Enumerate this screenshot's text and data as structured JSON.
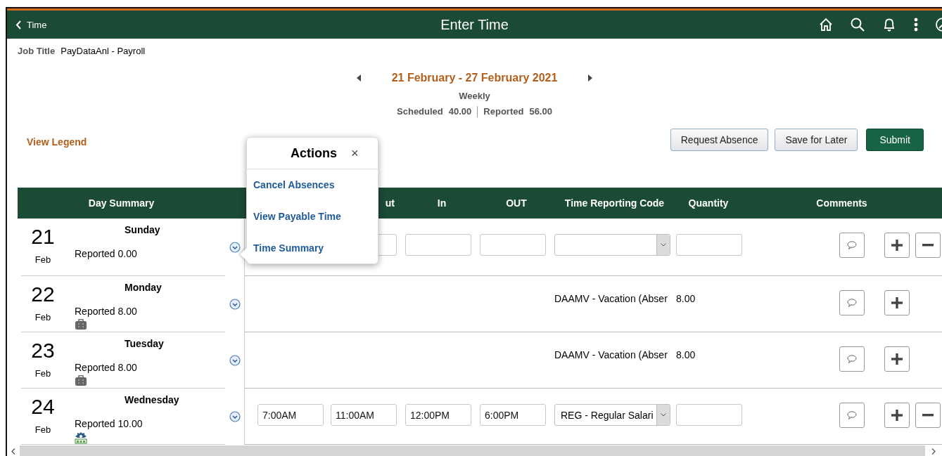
{
  "header": {
    "back_label": "Time",
    "title": "Enter Time"
  },
  "job": {
    "label": "Job Title",
    "value": "PayDataAnl - Payroll"
  },
  "period": {
    "range": "21 February - 27 February 2021",
    "frequency": "Weekly",
    "scheduled_label": "Scheduled",
    "scheduled": "40.00",
    "reported_label": "Reported",
    "reported": "56.00"
  },
  "legend_link": "View Legend",
  "buttons": [
    {
      "label": "Request Absence",
      "kind": "secondary"
    },
    {
      "label": "Save for Later",
      "kind": "secondary"
    },
    {
      "label": "Submit",
      "kind": "primary"
    }
  ],
  "columns": [
    {
      "label": "Day Summary"
    },
    {
      "label": "ut"
    },
    {
      "label": "In"
    },
    {
      "label": "OUT"
    },
    {
      "label": "Time Reporting Code"
    },
    {
      "label": "Quantity"
    },
    {
      "label": "Comments"
    }
  ],
  "days": [
    {
      "day": "21",
      "month": "Feb",
      "weekday": "Sunday",
      "reported": "Reported 0.00",
      "entry": {
        "kind": "blank"
      },
      "removable": true
    },
    {
      "day": "22",
      "month": "Feb",
      "weekday": "Monday",
      "reported": "Reported 8.00",
      "indicator": {
        "kind": "absence"
      },
      "entry": {
        "kind": "absence",
        "code": "DAAMV - Vacation (Abser",
        "quantity": "8.00"
      },
      "removable": false
    },
    {
      "day": "23",
      "month": "Feb",
      "weekday": "Tuesday",
      "reported": "Reported 8.00",
      "indicator": {
        "kind": "absence"
      },
      "entry": {
        "kind": "absence",
        "code": "DAAMV - Vacation (Abser",
        "quantity": "8.00"
      },
      "removable": false
    },
    {
      "day": "24",
      "month": "Feb",
      "weekday": "Wednesday",
      "reported": "Reported 10.00",
      "indicator": {
        "kind": "schedule"
      },
      "entry": {
        "kind": "punch",
        "times": [
          "7:00AM",
          "11:00AM",
          "12:00PM",
          "6:00PM"
        ],
        "code": "REG - Regular Salari"
      },
      "removable": true
    }
  ],
  "actions_menu": {
    "title": "Actions",
    "close": "×",
    "items": [
      "Cancel Absences",
      "View Payable Time",
      "Time Summary"
    ]
  }
}
